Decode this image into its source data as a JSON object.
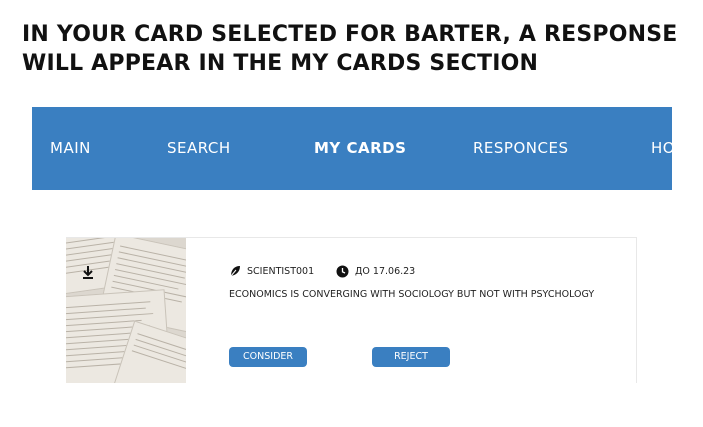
{
  "headline": {
    "line1": "IN YOUR CARD SELECTED FOR BARTER, A RESPONSE",
    "line2": "WILL APPEAR IN THE MY CARDS SECTION"
  },
  "nav": {
    "items": [
      {
        "label": "MAIN"
      },
      {
        "label": "SEARCH"
      },
      {
        "label": "MY CARDS",
        "active": true
      },
      {
        "label": "RESPONCES"
      },
      {
        "label": "HO"
      }
    ],
    "background": "#3a7fc1"
  },
  "card": {
    "image_icon": "download-icon",
    "author": "SCIENTIST001",
    "author_icon": "leaf-icon",
    "deadline": "ДО 17.06.23",
    "deadline_icon": "clock-icon",
    "description": "ECONOMICS IS CONVERGING WITH SOCIOLOGY BUT NOT WITH PSYCHOLOGY",
    "consider_label": "CONSIDER",
    "reject_label": "REJECT",
    "accent": "#3a7fc1"
  }
}
